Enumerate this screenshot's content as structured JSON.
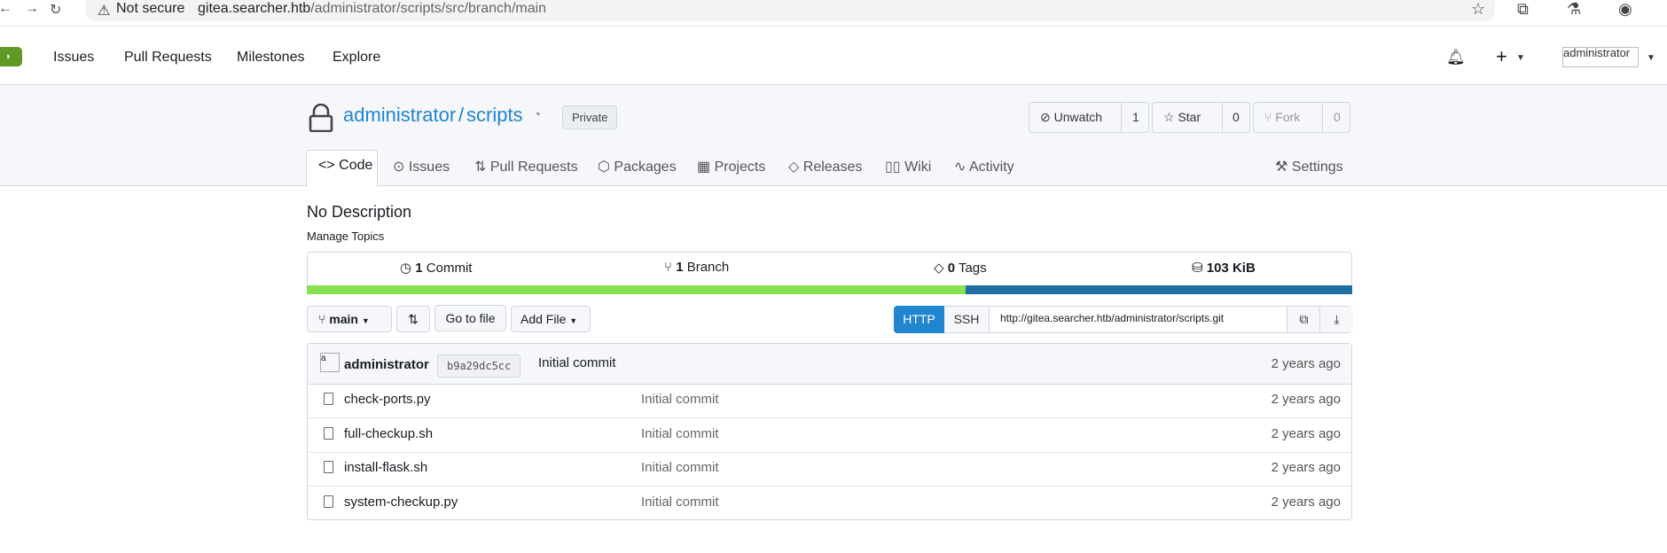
{
  "browser": {
    "security_label": "Not secure",
    "url_host": "gitea.searcher.htb",
    "url_path": "/administrator/scripts/src/branch/main"
  },
  "icons": {
    "back": "back-arrow-icon",
    "forward": "forward-arrow-icon",
    "reload": "reload-icon",
    "warning": "warning-icon",
    "star": "star-icon",
    "extensions": "extensions-icon",
    "labs": "labs-icon",
    "profile": "profile-icon"
  },
  "topnav": {
    "items": [
      "Issues",
      "Pull Requests",
      "Milestones",
      "Explore"
    ],
    "avatar_alt": "administrator"
  },
  "repo": {
    "owner": "administrator",
    "separator": "/",
    "name": "scripts",
    "visibility": "Private",
    "watch_label": "Unwatch",
    "watch_count": "1",
    "star_label": "Star",
    "star_count": "0",
    "fork_label": "Fork",
    "fork_count": "0"
  },
  "tabs": {
    "code": "Code",
    "issues": "Issues",
    "pulls": "Pull Requests",
    "packages": "Packages",
    "projects": "Projects",
    "releases": "Releases",
    "wiki": "Wiki",
    "activity": "Activity",
    "settings": "Settings"
  },
  "summary": {
    "description": "No Description",
    "manage_topics": "Manage Topics",
    "commits_count": "1",
    "commits_label": "Commit",
    "branches_count": "1",
    "branches_label": "Branch",
    "tags_count": "0",
    "tags_label": "Tags",
    "size": "103 KiB",
    "language_bar": [
      {
        "share": 0.63,
        "color": "#89e051"
      },
      {
        "share": 0.37,
        "color": "#1f6fa3"
      }
    ]
  },
  "toolbar": {
    "branch": "main",
    "go_to_file": "Go to file",
    "add_file": "Add File",
    "http": "HTTP",
    "ssh": "SSH",
    "clone_url": "http://gitea.searcher.htb/administrator/scripts.git"
  },
  "latest_commit": {
    "avatar_alt": "a",
    "author": "administrator",
    "sha": "b9a29dc5cc",
    "message": "Initial commit",
    "time": "2 years ago"
  },
  "files": [
    {
      "name": "check-ports.py",
      "message": "Initial commit",
      "time": "2 years ago"
    },
    {
      "name": "full-checkup.sh",
      "message": "Initial commit",
      "time": "2 years ago"
    },
    {
      "name": "install-flask.sh",
      "message": "Initial commit",
      "time": "2 years ago"
    },
    {
      "name": "system-checkup.py",
      "message": "Initial commit",
      "time": "2 years ago"
    }
  ],
  "colors": {
    "accent": "#2185d0",
    "brand": "#609926"
  }
}
